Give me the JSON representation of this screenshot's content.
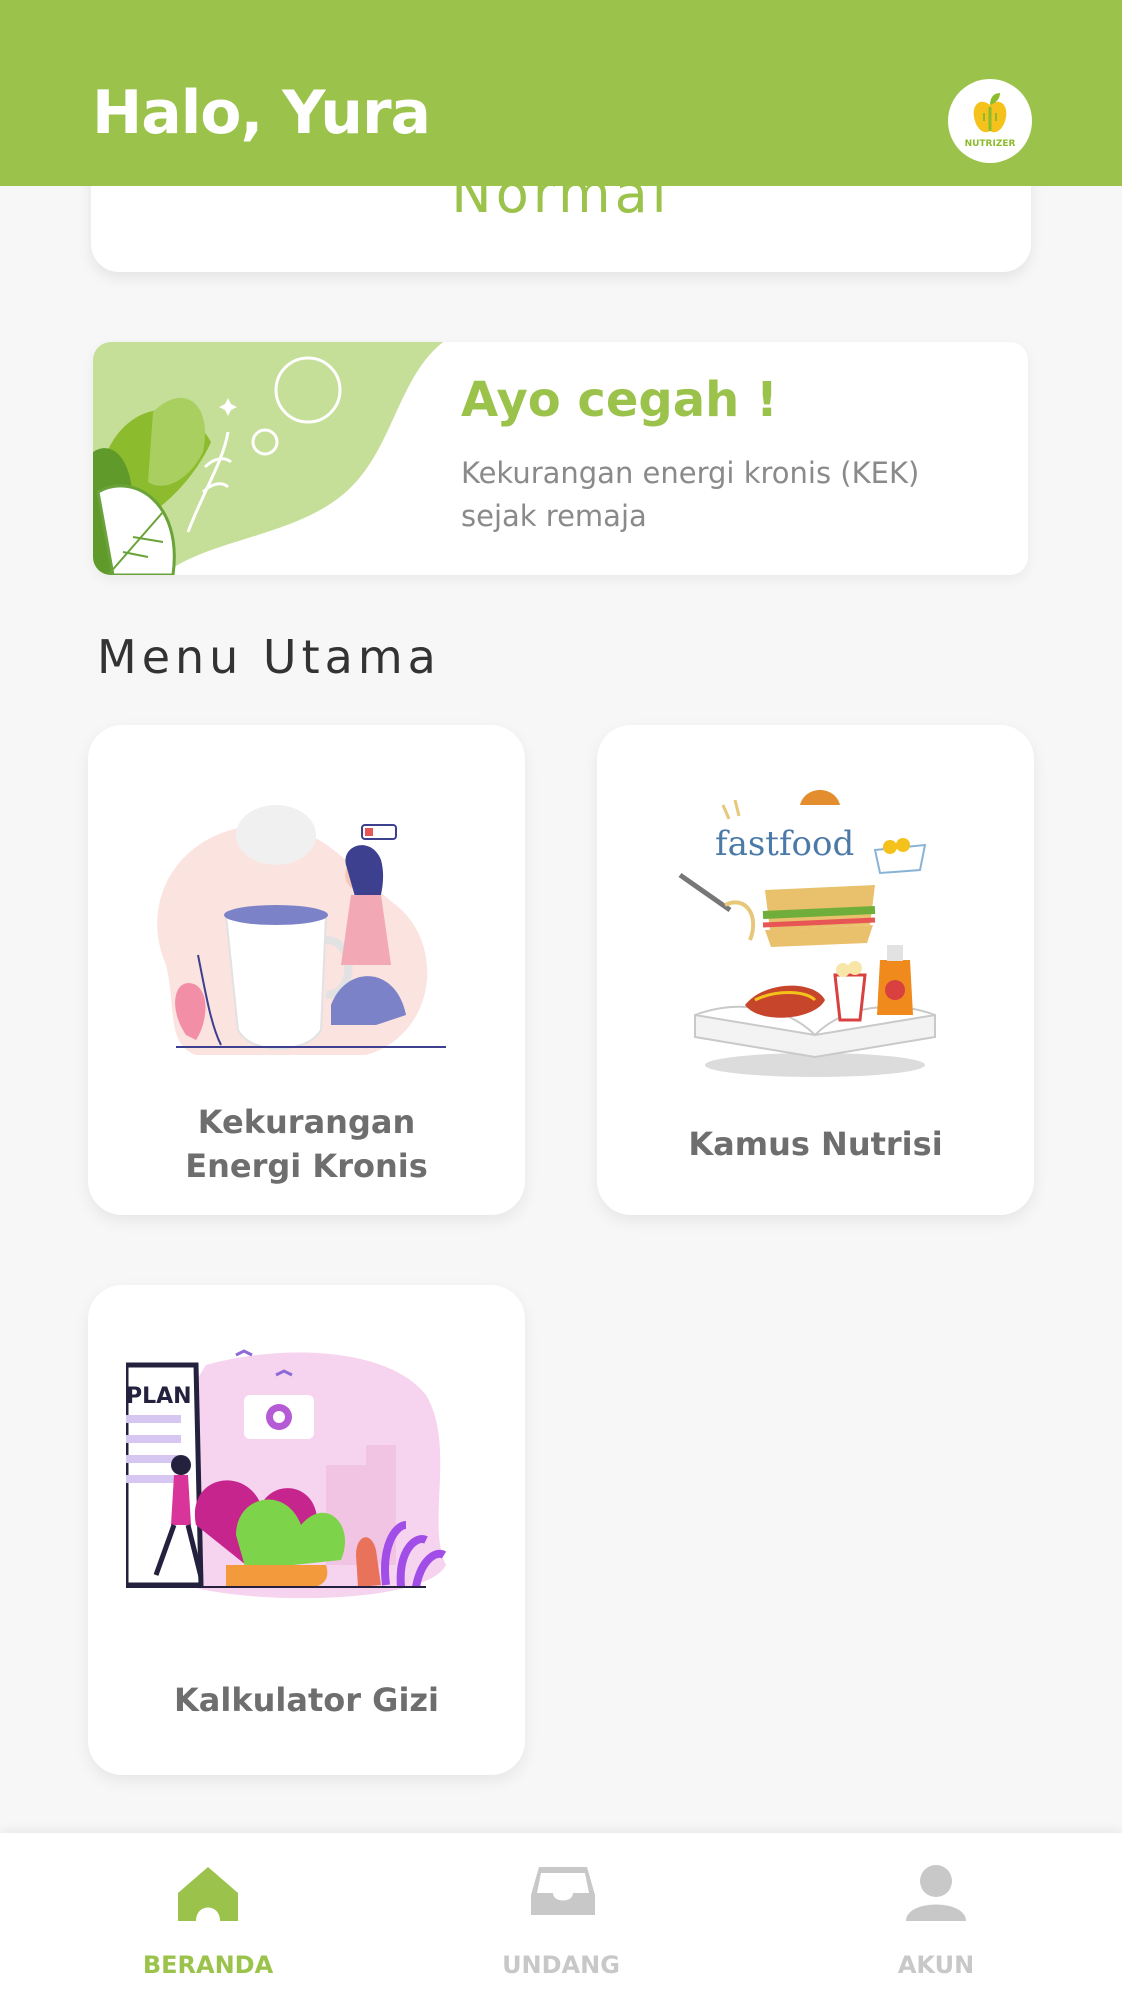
{
  "header": {
    "greeting": "Halo, Yura",
    "logo_text": "NUTRIZER"
  },
  "status_card": {
    "value": "Normal"
  },
  "banner": {
    "title": "Ayo cegah !",
    "text": "Kekurangan energi kronis (KEK) sejak remaja"
  },
  "menu": {
    "title": "Menu Utama",
    "items": [
      {
        "label_line1": "Kekurangan",
        "label_line2": "Energi Kronis",
        "icon": "woman-with-cup-illustration"
      },
      {
        "label": "Kamus Nutrisi",
        "icon": "fastfood-book-illustration",
        "art_text": "fastfood"
      },
      {
        "label": "Kalkulator Gizi",
        "icon": "meal-plan-illustration",
        "art_text": "PLAN"
      }
    ]
  },
  "bottom_nav": {
    "items": [
      {
        "label": "BERANDA",
        "icon": "home-icon",
        "active": true
      },
      {
        "label": "UNDANG",
        "icon": "inbox-icon",
        "active": false
      },
      {
        "label": "AKUN",
        "icon": "user-icon",
        "active": false
      }
    ]
  },
  "colors": {
    "primary": "#9bc34c",
    "inactive": "#c8c8c8",
    "background": "#f7f7f7",
    "label": "#6e6e6e"
  }
}
